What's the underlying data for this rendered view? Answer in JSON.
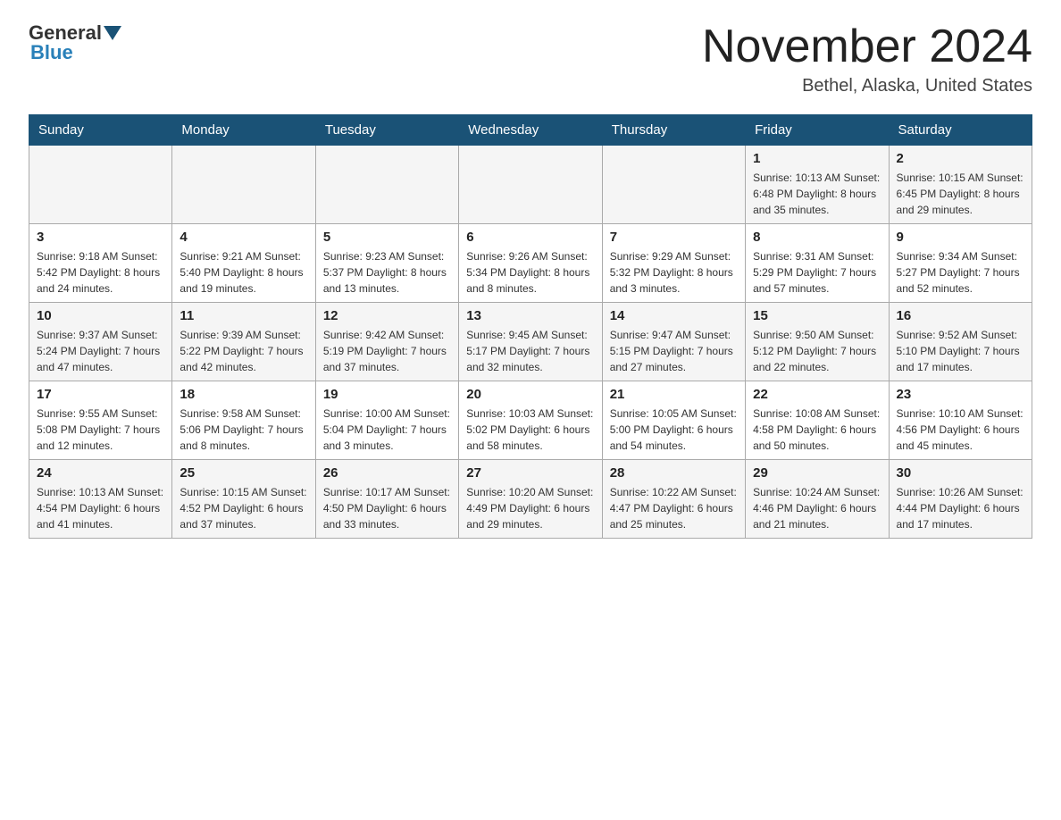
{
  "header": {
    "logo_general": "General",
    "logo_blue": "Blue",
    "title": "November 2024",
    "subtitle": "Bethel, Alaska, United States"
  },
  "weekdays": [
    "Sunday",
    "Monday",
    "Tuesday",
    "Wednesday",
    "Thursday",
    "Friday",
    "Saturday"
  ],
  "weeks": [
    [
      {
        "day": "",
        "info": ""
      },
      {
        "day": "",
        "info": ""
      },
      {
        "day": "",
        "info": ""
      },
      {
        "day": "",
        "info": ""
      },
      {
        "day": "",
        "info": ""
      },
      {
        "day": "1",
        "info": "Sunrise: 10:13 AM\nSunset: 6:48 PM\nDaylight: 8 hours\nand 35 minutes."
      },
      {
        "day": "2",
        "info": "Sunrise: 10:15 AM\nSunset: 6:45 PM\nDaylight: 8 hours\nand 29 minutes."
      }
    ],
    [
      {
        "day": "3",
        "info": "Sunrise: 9:18 AM\nSunset: 5:42 PM\nDaylight: 8 hours\nand 24 minutes."
      },
      {
        "day": "4",
        "info": "Sunrise: 9:21 AM\nSunset: 5:40 PM\nDaylight: 8 hours\nand 19 minutes."
      },
      {
        "day": "5",
        "info": "Sunrise: 9:23 AM\nSunset: 5:37 PM\nDaylight: 8 hours\nand 13 minutes."
      },
      {
        "day": "6",
        "info": "Sunrise: 9:26 AM\nSunset: 5:34 PM\nDaylight: 8 hours\nand 8 minutes."
      },
      {
        "day": "7",
        "info": "Sunrise: 9:29 AM\nSunset: 5:32 PM\nDaylight: 8 hours\nand 3 minutes."
      },
      {
        "day": "8",
        "info": "Sunrise: 9:31 AM\nSunset: 5:29 PM\nDaylight: 7 hours\nand 57 minutes."
      },
      {
        "day": "9",
        "info": "Sunrise: 9:34 AM\nSunset: 5:27 PM\nDaylight: 7 hours\nand 52 minutes."
      }
    ],
    [
      {
        "day": "10",
        "info": "Sunrise: 9:37 AM\nSunset: 5:24 PM\nDaylight: 7 hours\nand 47 minutes."
      },
      {
        "day": "11",
        "info": "Sunrise: 9:39 AM\nSunset: 5:22 PM\nDaylight: 7 hours\nand 42 minutes."
      },
      {
        "day": "12",
        "info": "Sunrise: 9:42 AM\nSunset: 5:19 PM\nDaylight: 7 hours\nand 37 minutes."
      },
      {
        "day": "13",
        "info": "Sunrise: 9:45 AM\nSunset: 5:17 PM\nDaylight: 7 hours\nand 32 minutes."
      },
      {
        "day": "14",
        "info": "Sunrise: 9:47 AM\nSunset: 5:15 PM\nDaylight: 7 hours\nand 27 minutes."
      },
      {
        "day": "15",
        "info": "Sunrise: 9:50 AM\nSunset: 5:12 PM\nDaylight: 7 hours\nand 22 minutes."
      },
      {
        "day": "16",
        "info": "Sunrise: 9:52 AM\nSunset: 5:10 PM\nDaylight: 7 hours\nand 17 minutes."
      }
    ],
    [
      {
        "day": "17",
        "info": "Sunrise: 9:55 AM\nSunset: 5:08 PM\nDaylight: 7 hours\nand 12 minutes."
      },
      {
        "day": "18",
        "info": "Sunrise: 9:58 AM\nSunset: 5:06 PM\nDaylight: 7 hours\nand 8 minutes."
      },
      {
        "day": "19",
        "info": "Sunrise: 10:00 AM\nSunset: 5:04 PM\nDaylight: 7 hours\nand 3 minutes."
      },
      {
        "day": "20",
        "info": "Sunrise: 10:03 AM\nSunset: 5:02 PM\nDaylight: 6 hours\nand 58 minutes."
      },
      {
        "day": "21",
        "info": "Sunrise: 10:05 AM\nSunset: 5:00 PM\nDaylight: 6 hours\nand 54 minutes."
      },
      {
        "day": "22",
        "info": "Sunrise: 10:08 AM\nSunset: 4:58 PM\nDaylight: 6 hours\nand 50 minutes."
      },
      {
        "day": "23",
        "info": "Sunrise: 10:10 AM\nSunset: 4:56 PM\nDaylight: 6 hours\nand 45 minutes."
      }
    ],
    [
      {
        "day": "24",
        "info": "Sunrise: 10:13 AM\nSunset: 4:54 PM\nDaylight: 6 hours\nand 41 minutes."
      },
      {
        "day": "25",
        "info": "Sunrise: 10:15 AM\nSunset: 4:52 PM\nDaylight: 6 hours\nand 37 minutes."
      },
      {
        "day": "26",
        "info": "Sunrise: 10:17 AM\nSunset: 4:50 PM\nDaylight: 6 hours\nand 33 minutes."
      },
      {
        "day": "27",
        "info": "Sunrise: 10:20 AM\nSunset: 4:49 PM\nDaylight: 6 hours\nand 29 minutes."
      },
      {
        "day": "28",
        "info": "Sunrise: 10:22 AM\nSunset: 4:47 PM\nDaylight: 6 hours\nand 25 minutes."
      },
      {
        "day": "29",
        "info": "Sunrise: 10:24 AM\nSunset: 4:46 PM\nDaylight: 6 hours\nand 21 minutes."
      },
      {
        "day": "30",
        "info": "Sunrise: 10:26 AM\nSunset: 4:44 PM\nDaylight: 6 hours\nand 17 minutes."
      }
    ]
  ]
}
